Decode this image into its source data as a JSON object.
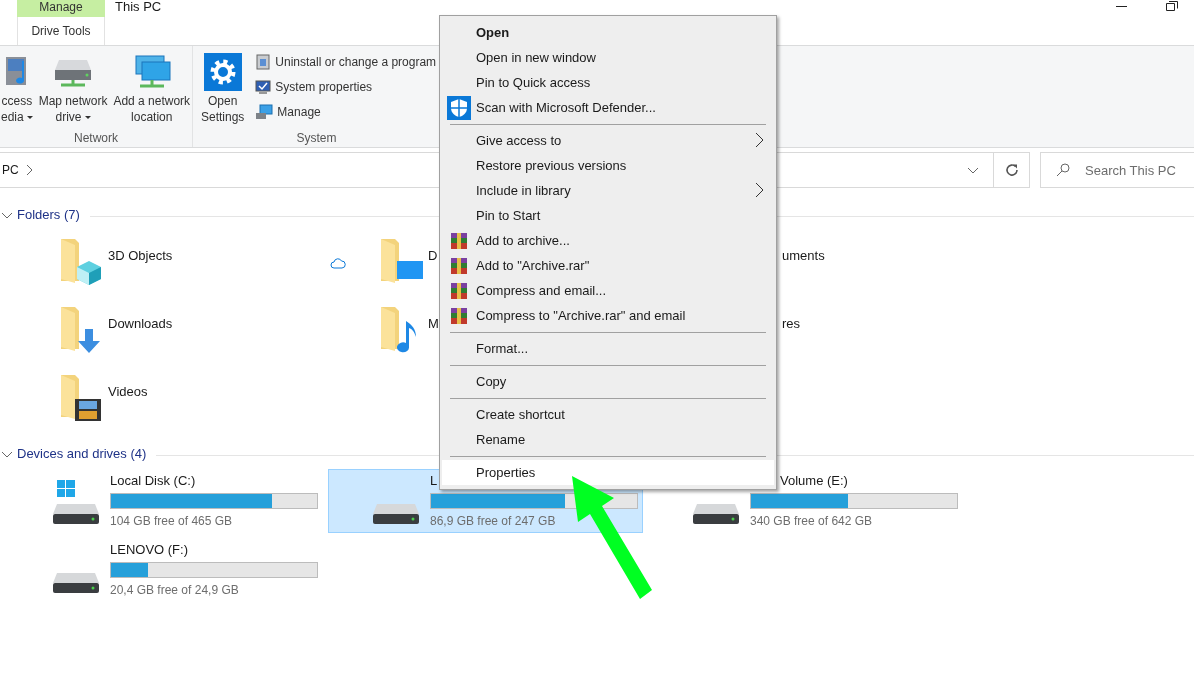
{
  "title_bar": {
    "context_tab": "Manage",
    "context_group": "Drive Tools",
    "title": "This PC"
  },
  "ribbon": {
    "groups": [
      {
        "label": "Network",
        "items": [
          {
            "kind": "media",
            "lines": [
              "ccess",
              "edia"
            ],
            "dropdown": true
          },
          {
            "kind": "map-drive",
            "lines": [
              "Map network",
              "drive"
            ],
            "dropdown": true
          },
          {
            "kind": "network-location",
            "lines": [
              "Add a network",
              "location"
            ],
            "dropdown": false
          }
        ]
      },
      {
        "label": "System",
        "items": [
          {
            "kind": "settings",
            "lines": [
              "Open",
              "Settings"
            ],
            "dropdown": false
          }
        ],
        "small_items": [
          {
            "kind": "uninstall",
            "label": "Uninstall or change a program"
          },
          {
            "kind": "system-properties",
            "label": "System properties"
          },
          {
            "kind": "manage",
            "label": "Manage"
          }
        ]
      }
    ]
  },
  "address_bar": {
    "path": "PC",
    "search_placeholder": "Search This PC"
  },
  "folders": {
    "header": "Folders (7)",
    "items": [
      {
        "name": "3D Objects",
        "kind": "objects"
      },
      {
        "name": "D",
        "kind": "desktop"
      },
      {
        "name": "uments",
        "kind": "hidden"
      },
      {
        "name": "Downloads",
        "kind": "downloads"
      },
      {
        "name": "M",
        "kind": "music"
      },
      {
        "name": "res",
        "kind": "hidden"
      },
      {
        "name": "Videos",
        "kind": "videos"
      }
    ]
  },
  "drives": {
    "header": "Devices and drives (4)",
    "items": [
      {
        "name": "Local Disk (C:)",
        "kind": "windows",
        "level": 0.78,
        "free": "104 GB free of 465 GB",
        "selected": false
      },
      {
        "name": "L",
        "kind": "disk",
        "level": 0.65,
        "free": "86,9 GB free of 247 GB",
        "selected": true
      },
      {
        "name": "Volume (E:)",
        "kind": "disk",
        "level": 0.47,
        "free": "340 GB free of 642 GB",
        "selected": false
      },
      {
        "name": "LENOVO (F:)",
        "kind": "disk",
        "level": 0.18,
        "free": "20,4 GB free of 24,9 GB",
        "selected": false
      }
    ]
  },
  "context_menu": [
    {
      "kind": "item",
      "label": "Open",
      "bold": true,
      "submenu": false,
      "selected": false
    },
    {
      "kind": "item",
      "label": "Open in new window",
      "bold": false,
      "submenu": false,
      "selected": false
    },
    {
      "kind": "item",
      "label": "Pin to Quick access",
      "bold": false,
      "submenu": false,
      "selected": false
    },
    {
      "kind": "defender-item",
      "label": "Scan with Microsoft Defender...",
      "bold": false,
      "submenu": false,
      "selected": false
    },
    {
      "kind": "separator"
    },
    {
      "kind": "item",
      "label": "Give access to",
      "bold": false,
      "submenu": true,
      "selected": false
    },
    {
      "kind": "item",
      "label": "Restore previous versions",
      "bold": false,
      "submenu": false,
      "selected": false
    },
    {
      "kind": "item",
      "label": "Include in library",
      "bold": false,
      "submenu": true,
      "selected": false
    },
    {
      "kind": "item",
      "label": "Pin to Start",
      "bold": false,
      "submenu": false,
      "selected": false
    },
    {
      "kind": "archive-item",
      "label": "Add to archive...",
      "bold": false,
      "submenu": false,
      "selected": false
    },
    {
      "kind": "archive-item",
      "label": "Add to \"Archive.rar\"",
      "bold": false,
      "submenu": false,
      "selected": false
    },
    {
      "kind": "archive-item",
      "label": "Compress and email...",
      "bold": false,
      "submenu": false,
      "selected": false
    },
    {
      "kind": "archive-item",
      "label": "Compress to \"Archive.rar\" and email",
      "bold": false,
      "submenu": false,
      "selected": false
    },
    {
      "kind": "separator"
    },
    {
      "kind": "item",
      "label": "Format...",
      "bold": false,
      "submenu": false,
      "selected": false
    },
    {
      "kind": "separator"
    },
    {
      "kind": "item",
      "label": "Copy",
      "bold": false,
      "submenu": false,
      "selected": false
    },
    {
      "kind": "separator"
    },
    {
      "kind": "item",
      "label": "Create shortcut",
      "bold": false,
      "submenu": false,
      "selected": false
    },
    {
      "kind": "item",
      "label": "Rename",
      "bold": false,
      "submenu": false,
      "selected": false
    },
    {
      "kind": "separator"
    },
    {
      "kind": "item",
      "label": "Properties",
      "bold": false,
      "submenu": false,
      "selected": true
    }
  ]
}
